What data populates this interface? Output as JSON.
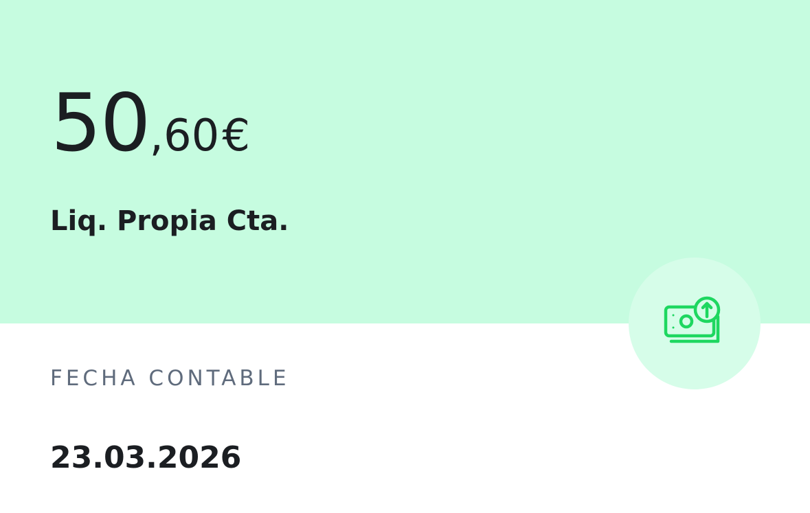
{
  "transaction": {
    "amount_integer": "50",
    "amount_decimal": ",60",
    "currency": "€",
    "concept": "Liq. Propia Cta."
  },
  "details": {
    "date_label": "FECHA CONTABLE",
    "date_value": "23.03.2026"
  },
  "icon": {
    "name": "money-transfer-up-icon",
    "color": "#1ed760"
  },
  "colors": {
    "hero_background": "#c6fce0",
    "icon_circle": "#d6fde9",
    "text_primary": "#1b1e22",
    "text_secondary": "#5f6b7c"
  }
}
